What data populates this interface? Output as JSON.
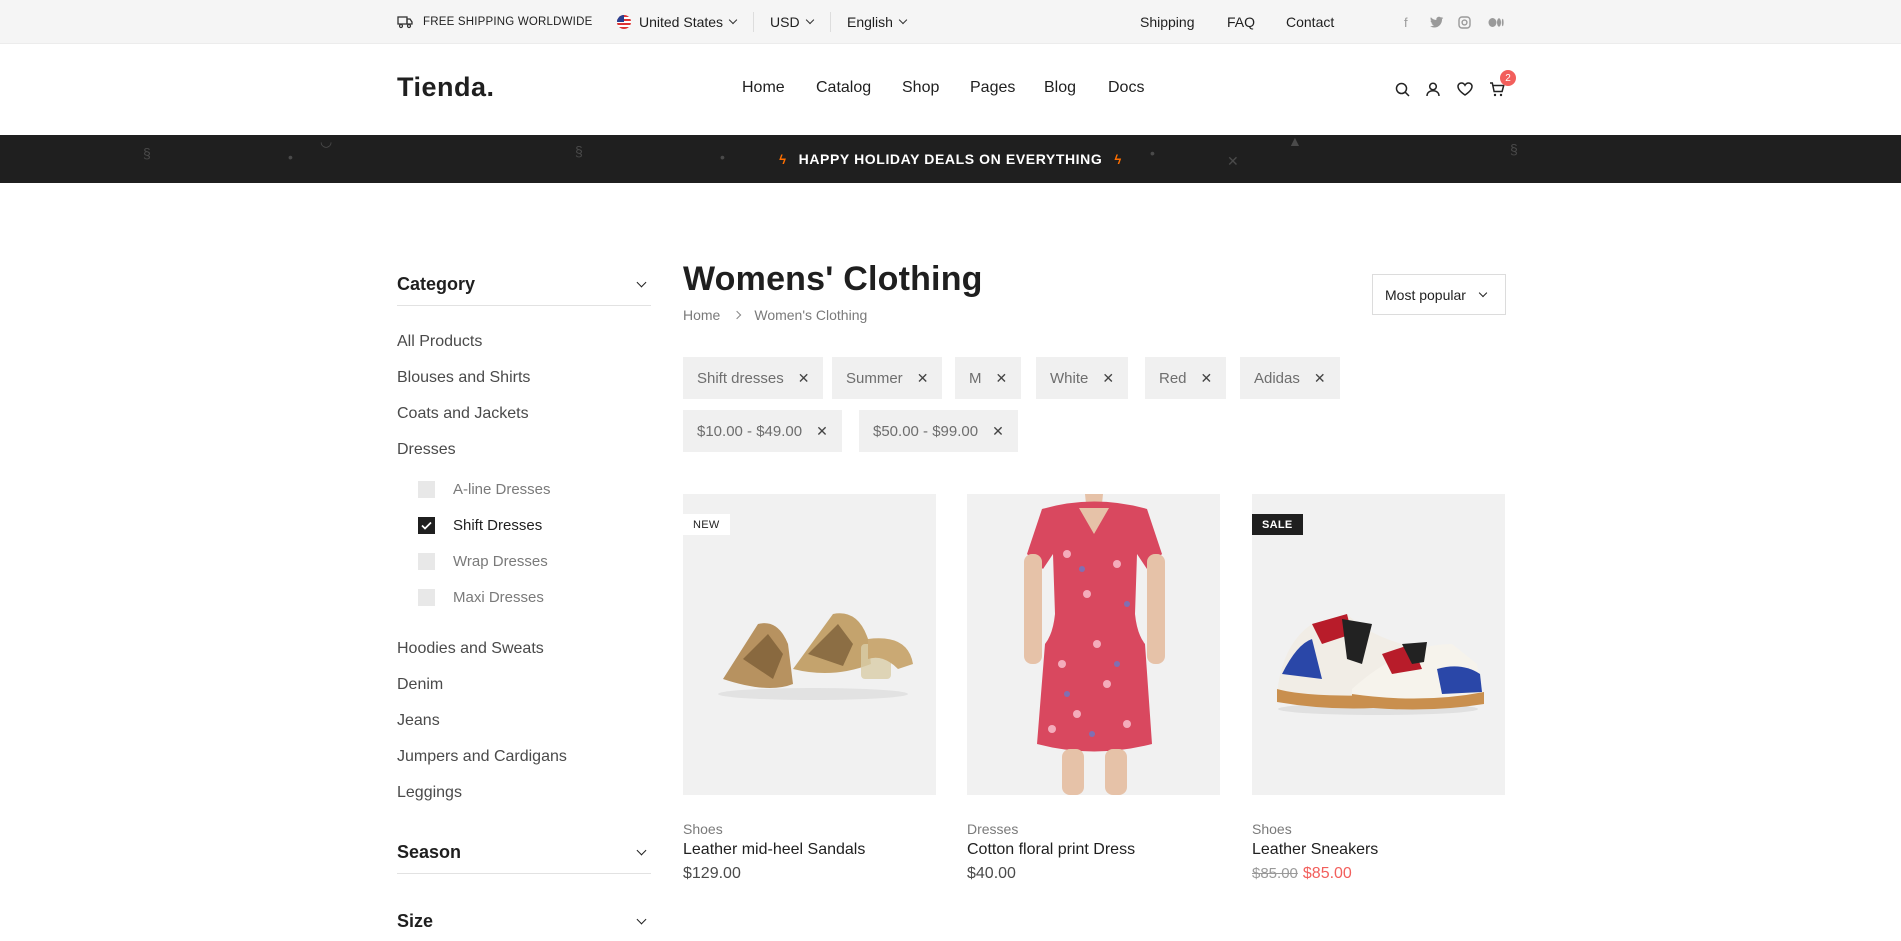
{
  "topbar": {
    "shipping_text": "FREE SHIPPING WORLDWIDE",
    "country": "United States",
    "currency": "USD",
    "language": "English",
    "links": [
      "Shipping",
      "FAQ",
      "Contact"
    ],
    "social_icons": [
      "facebook-icon",
      "twitter-icon",
      "instagram-icon",
      "medium-icon"
    ]
  },
  "header": {
    "logo": "Tienda.",
    "nav": [
      "Home",
      "Catalog",
      "Shop",
      "Pages",
      "Blog",
      "Docs"
    ],
    "cart_count": "2",
    "icons": [
      "search-icon",
      "user-icon",
      "heart-icon",
      "cart-icon"
    ]
  },
  "promo": {
    "text": "HAPPY HOLIDAY DEALS ON EVERYTHING"
  },
  "sidebar": {
    "category_title": "Category",
    "categories": [
      "All Products",
      "Blouses and Shirts",
      "Coats and Jackets",
      "Dresses"
    ],
    "dress_types": [
      {
        "label": "A-line Dresses",
        "checked": false
      },
      {
        "label": "Shift Dresses",
        "checked": true
      },
      {
        "label": "Wrap Dresses",
        "checked": false
      },
      {
        "label": "Maxi Dresses",
        "checked": false
      }
    ],
    "more_categories": [
      "Hoodies and Sweats",
      "Denim",
      "Jeans",
      "Jumpers and Cardigans",
      "Leggings"
    ],
    "season_title": "Season",
    "size_title": "Size"
  },
  "main": {
    "title": "Womens' Clothing",
    "breadcrumb": [
      "Home",
      "Women's Clothing"
    ],
    "sort": "Most popular",
    "filters": [
      "Shift dresses",
      "Summer",
      "M",
      "White",
      "Red",
      "Adidas",
      "$10.00 - $49.00",
      "$50.00 - $99.00"
    ]
  },
  "products": [
    {
      "badge": "NEW",
      "category": "Shoes",
      "name": "Leather mid-heel Sandals",
      "price": "$129.00",
      "old_price": "",
      "sale_price": ""
    },
    {
      "badge": "",
      "category": "Dresses",
      "name": "Cotton floral print Dress",
      "price": "$40.00",
      "old_price": "",
      "sale_price": ""
    },
    {
      "badge": "SALE",
      "category": "Shoes",
      "name": "Leather Sneakers",
      "price": "",
      "old_price": "$85.00",
      "sale_price": "$85.00"
    }
  ],
  "colors": {
    "accent": "#f25f5c",
    "dark": "#1f1f1f",
    "bolt": "#ff6f00"
  }
}
